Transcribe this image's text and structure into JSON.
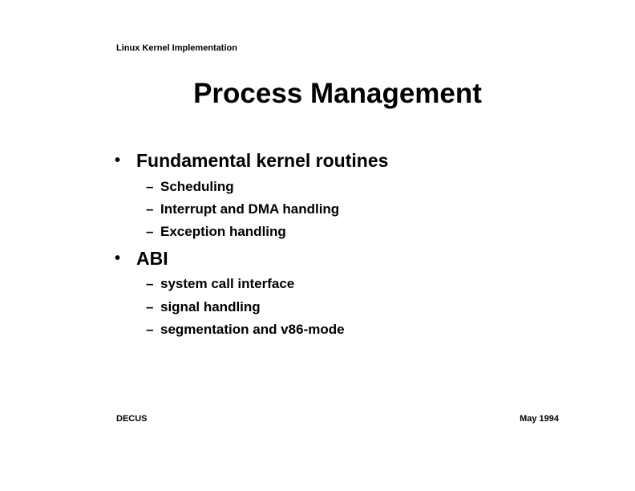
{
  "header": {
    "text": "Linux Kernel Implementation"
  },
  "title": "Process Management",
  "bullets": [
    {
      "marker": "•",
      "label": "Fundamental kernel routines",
      "subitems": [
        {
          "marker": "–",
          "label": "Scheduling"
        },
        {
          "marker": "–",
          "label": "Interrupt and DMA handling"
        },
        {
          "marker": "–",
          "label": "Exception handling"
        }
      ]
    },
    {
      "marker": "•",
      "label": "ABI",
      "subitems": [
        {
          "marker": "–",
          "label": "system call interface"
        },
        {
          "marker": "–",
          "label": "signal handling"
        },
        {
          "marker": "–",
          "label": "segmentation and v86-mode"
        }
      ]
    }
  ],
  "footer": {
    "left": "DECUS",
    "right": "May 1994"
  }
}
